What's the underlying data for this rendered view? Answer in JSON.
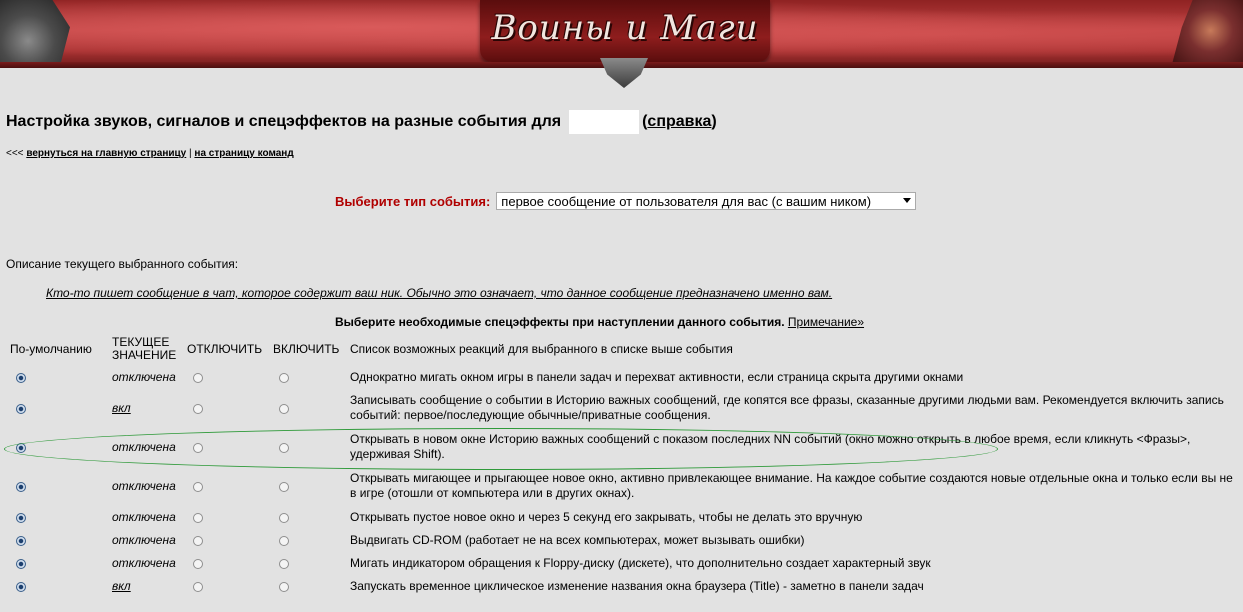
{
  "banner": {
    "logo_text": "Воины и Маги"
  },
  "header": {
    "title": "Настройка звуков, сигналов и спецэффектов на разные события для",
    "help_link": "справка",
    "paren_open": "(",
    "paren_close": ")"
  },
  "nav": {
    "prefix": "<<<",
    "back_link": "вернуться на главную страницу",
    "separator": "|",
    "commands_link": "на страницу команд"
  },
  "event_selector": {
    "label": "Выберите тип события:",
    "selected": "первое сообщение от пользователя для вас (с вашим ником)"
  },
  "description": {
    "label": "Описание текущего выбранного события:",
    "text": "Кто-то пишет сообщение в чат, которое содержит ваш ник. Обычно это означает, что данное сообщение предназначено именно вам."
  },
  "effects": {
    "title": "Выберите необходимые спецэффекты при наступлении данного события.",
    "note_link": "Примечание»"
  },
  "table": {
    "headers": {
      "default": "По-умолчанию",
      "current_line1": "ТЕКУЩЕЕ",
      "current_line2": "ЗНАЧЕНИЕ",
      "disable": "ОТКЛЮЧИТЬ",
      "enable": "ВКЛЮЧИТЬ",
      "reactions": "Список возможных реакций для выбранного в списке выше события"
    },
    "rows": [
      {
        "current": "отключена",
        "desc": "Однократно мигать окном игры в панели задач и перехват активности, если страница скрыта другими окнами"
      },
      {
        "current": "вкл",
        "desc": "Записывать сообщение о событии в Историю важных сообщений, где копятся все фразы, сказанные другими людьми вам. Рекомендуется включить запись событий: первое/последующие обычные/приватные сообщения."
      },
      {
        "current": "отключена",
        "desc": "Открывать в новом окне Историю важных сообщений с показом последних NN событий (окно можно открыть в любое время, если кликнуть <Фразы>, удерживая Shift)."
      },
      {
        "current": "отключена",
        "desc": "Открывать мигающее и прыгающее новое окно, активно привлекающее внимание. На каждое событие создаются новые отдельные окна и только если вы не в игре (отошли от компьютера или в других окнах)."
      },
      {
        "current": "отключена",
        "desc": "Открывать пустое новое окно и через 5 секунд его закрывать, чтобы не делать это вручную"
      },
      {
        "current": "отключена",
        "desc": "Выдвигать CD-ROM (работает не на всех компьютерах, может вызывать ошибки)"
      },
      {
        "current": "отключена",
        "desc": "Мигать индикатором обращения к Floppy-диску (дискете), что дополнительно создает характерный звук"
      },
      {
        "current": "вкл",
        "desc": "Запускать временное циклическое изменение названия окна браузера (Title) - заметно в панели задач"
      }
    ]
  }
}
